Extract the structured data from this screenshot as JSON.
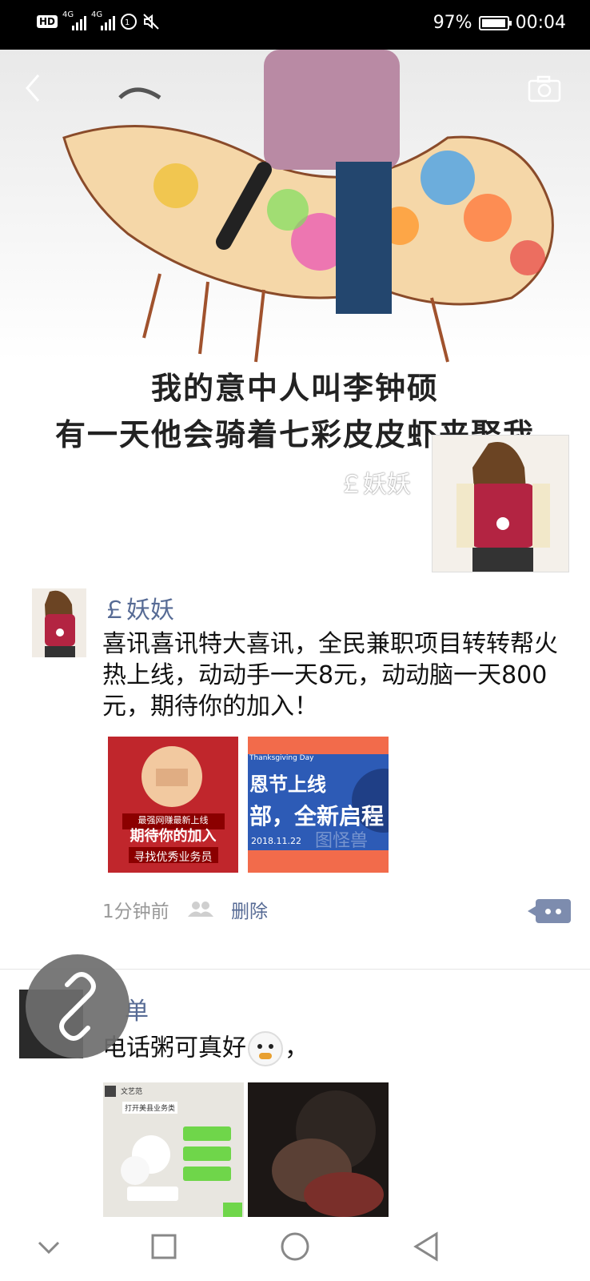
{
  "status_bar": {
    "hd": "HD",
    "network_1": "4G",
    "network_2": "4G",
    "battery_percent": "97%",
    "battery_level": 0.97,
    "time": "00:04"
  },
  "cover": {
    "line1": "我的意中人叫李钟硕",
    "line2": "有一天他会骑着七彩皮皮虾来娶我"
  },
  "profile": {
    "name": "￡妖妖"
  },
  "posts": [
    {
      "author": "￡妖妖",
      "text": "喜讯喜讯特大喜讯，全民兼职项目转转帮火热上线，动动手一天8元，动动脑一天800元，期待你的加入！",
      "images": [
        {
          "line1": "最强网赚最新上线",
          "line2": "期待你的加入",
          "line3": "寻找优秀业务员"
        },
        {
          "caption_small": "Thanksgiving Day",
          "line1": "恩节上线",
          "line2": "部，全新启程",
          "date": "2018.11.22",
          "watermark": "图怪兽"
        }
      ],
      "time": "1分钟前",
      "delete": "删除"
    },
    {
      "author_visible": "单",
      "text": "电话粥可真好",
      "text_suffix": "，",
      "images": [
        {
          "label_top": "文艺范",
          "label_bottom": "打开美县业务类"
        },
        {}
      ]
    }
  ],
  "colors": {
    "link": "#576b95",
    "status_bg": "#000000"
  }
}
